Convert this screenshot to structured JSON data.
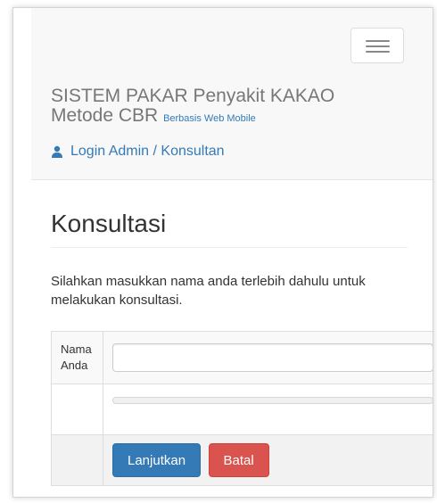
{
  "navbar": {
    "brand_title": "SISTEM PAKAR Penyakit KAKAO",
    "brand_method": "Metode CBR",
    "brand_tagline": "Berbasis Web Mobile",
    "login_link": "Login Admin / Konsultan"
  },
  "main": {
    "title": "Konsultasi",
    "instruction": "Silahkan masukkan nama anda terlebih dahulu untuk melakukan konsultasi.",
    "form": {
      "name_label_line1": "Nama",
      "name_label_line2": "Anda",
      "name_value": "",
      "submit_label": "Lanjutkan",
      "cancel_label": "Batal"
    }
  },
  "icons": {
    "menu": "hamburger-icon",
    "user": "user-icon"
  },
  "colors": {
    "link": "#337ab7",
    "primary_button": "#337ab7",
    "danger_button": "#d9534f",
    "brand_text": "#777777",
    "navbar_bg": "#f8f8f8"
  }
}
